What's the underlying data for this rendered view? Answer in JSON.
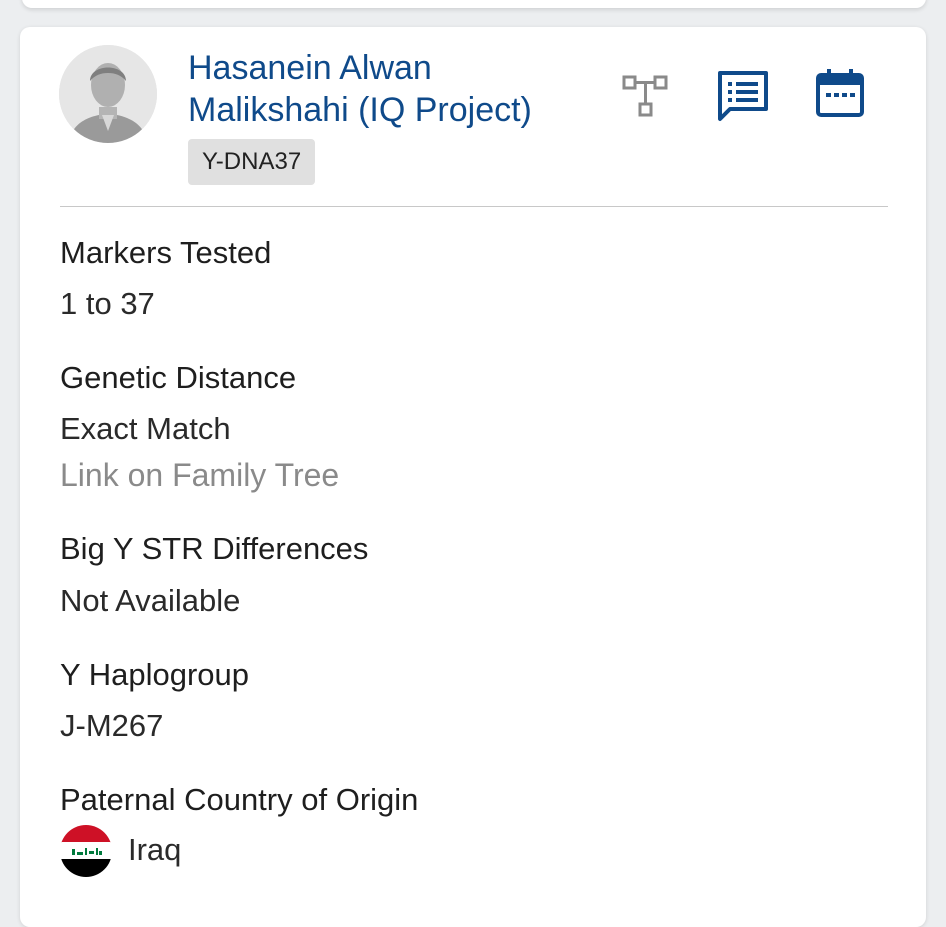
{
  "match": {
    "name_line1": "Hasanein Alwan",
    "name_line2": "Malikshahi (IQ Project)",
    "test_badge": "Y-DNA37",
    "actions": [
      {
        "icon": "family-tree-icon"
      },
      {
        "icon": "notes-icon"
      },
      {
        "icon": "calendar-icon"
      }
    ]
  },
  "fields": {
    "markers_tested": {
      "label": "Markers Tested",
      "value": "1 to 37"
    },
    "genetic_distance": {
      "label": "Genetic Distance",
      "value": "Exact Match",
      "link": "Link on Family Tree"
    },
    "big_y_str": {
      "label": "Big Y STR Differences",
      "value": "Not Available"
    },
    "y_haplogroup": {
      "label": "Y Haplogroup",
      "value": "J-M267"
    },
    "paternal_origin": {
      "label": "Paternal Country of Origin",
      "value": "Iraq",
      "flag_icon": "iraq-flag-icon"
    }
  },
  "colors": {
    "accent": "#0f4a8a",
    "link_gray": "#8a8a8a",
    "badge_bg": "#e0e0e0"
  }
}
